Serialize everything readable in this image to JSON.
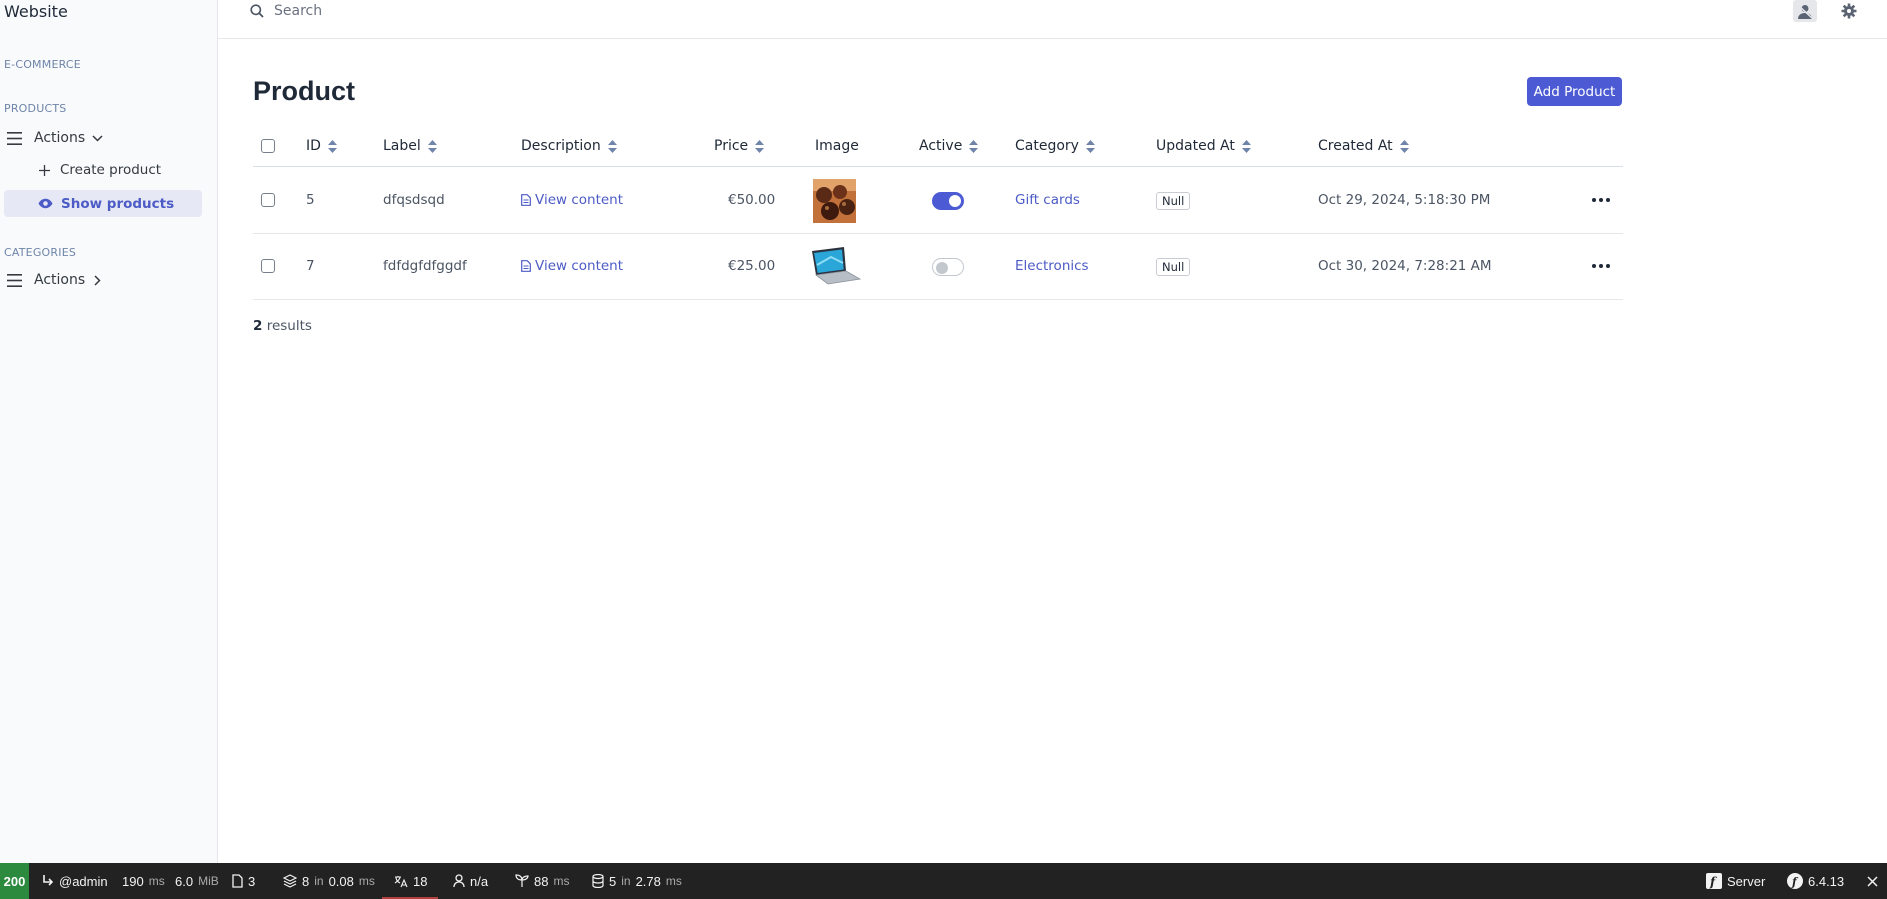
{
  "sidebar": {
    "brand": "Website",
    "sections": [
      {
        "title": "E-COMMERCE"
      },
      {
        "title": "PRODUCTS"
      },
      {
        "title": "CATEGORIES"
      }
    ],
    "products_actions_label": "Actions",
    "create_product_label": "Create product",
    "show_products_label": "Show products",
    "categories_actions_label": "Actions"
  },
  "topbar": {
    "search_placeholder": "Search"
  },
  "page": {
    "title": "Product",
    "add_button": "Add Product"
  },
  "table": {
    "columns": [
      "ID",
      "Label",
      "Description",
      "Price",
      "Image",
      "Active",
      "Category",
      "Updated At",
      "Created At"
    ],
    "rows": [
      {
        "id": "5",
        "label": "dfqsdsqd",
        "description": "View content",
        "price": "€50.00",
        "image": "chocolates-thumbnail",
        "active": true,
        "category": "Gift cards",
        "updated_at": "Null",
        "created_at": "Oct 29, 2024, 5:18:30 PM"
      },
      {
        "id": "7",
        "label": "fdfdgfdfggdf",
        "description": "View content",
        "price": "€25.00",
        "image": "laptop-thumbnail",
        "active": false,
        "category": "Electronics",
        "updated_at": "Null",
        "created_at": "Oct 30, 2024, 7:28:21 AM"
      }
    ],
    "results_count": "2",
    "results_label": "results"
  },
  "debug_toolbar": {
    "status": "200",
    "user": "@admin",
    "time_value": "190",
    "time_unit": "ms",
    "memory_value": "6.0",
    "memory_unit": "MiB",
    "forms": "3",
    "cache_count": "8",
    "cache_in": "in",
    "cache_time": "0.08",
    "cache_unit": "ms",
    "translations": "18",
    "security": "n/a",
    "twig_time": "88",
    "twig_unit": "ms",
    "db_count": "5",
    "db_in": "in",
    "db_time": "2.78",
    "db_unit": "ms",
    "server_label": "Server",
    "symfony_version": "6.4.13"
  },
  "colors": {
    "accent": "#4c5bd4",
    "status_ok": "#2b8a3e",
    "toolbar_bg": "#222222"
  }
}
